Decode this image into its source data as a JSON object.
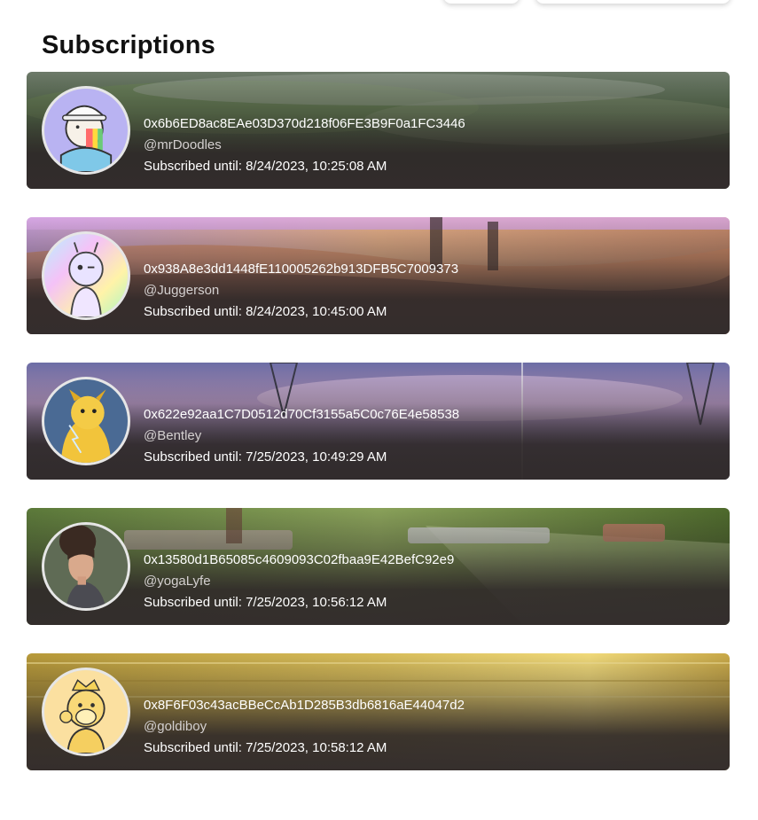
{
  "page": {
    "title": "Subscriptions"
  },
  "subscriptions": [
    {
      "address": "0x6b6ED8ac8EAe03D370d218f06FE3B9F0a1FC3446",
      "handle": "@mrDoodles",
      "until": "Subscribed until: 8/24/2023, 10:25:08 AM",
      "avatar_icon": "doodle-character-avatar",
      "banner": "green-landscape"
    },
    {
      "address": "0x938A8e3dd1448fE110005262b913DFB5C7009373",
      "handle": "@Juggerson",
      "until": "Subscribed until: 8/24/2023, 10:45:00 AM",
      "avatar_icon": "holographic-alien-avatar",
      "banner": "pink-mushroom-field"
    },
    {
      "address": "0x622e92aa1C7D0512d70Cf3155a5C0c76E4e58538",
      "handle": "@Bentley",
      "until": "Subscribed until: 7/25/2023, 10:49:29 AM",
      "avatar_icon": "yellow-dog-astronaut-avatar",
      "banner": "purple-sky-power-lines"
    },
    {
      "address": "0x13580d1B65085c4609093C02fbaa9E42BefC92e9",
      "handle": "@yogaLyfe",
      "until": "Subscribed until: 7/25/2023, 10:56:12 AM",
      "avatar_icon": "woman-portrait-avatar",
      "banner": "yoga-grass-park"
    },
    {
      "address": "0x8F6F03c43acBBeCcAb1D285B3db6816aE44047d2",
      "handle": "@goldiboy",
      "until": "Subscribed until: 7/25/2023, 10:58:12 AM",
      "avatar_icon": "gold-ape-crown-avatar",
      "banner": "gold-texture"
    }
  ]
}
